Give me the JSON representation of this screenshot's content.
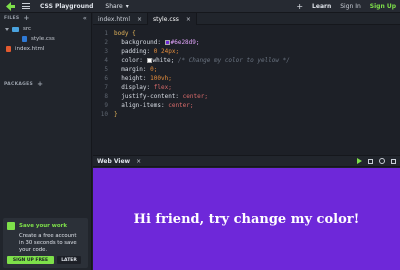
{
  "header": {
    "app_title": "CSS Playground",
    "share_label": "Share",
    "add_label": "+",
    "learn_label": "Learn",
    "sign_in_label": "Sign In",
    "sign_up_label": "Sign Up",
    "accent_color": "#7ee04a"
  },
  "sidebar": {
    "files_label": "FILES",
    "add_label": "+",
    "collapse_label": "«",
    "tree": {
      "folder": "src",
      "children": [
        "style.css"
      ],
      "root_files": [
        "index.html"
      ]
    },
    "packages_label": "PACKAGES",
    "packages_add": "+"
  },
  "save_card": {
    "title": "Save your work",
    "line1": "Create a free account",
    "line2": "in 30 seconds to save",
    "line3": "your code.",
    "signup_label": "SIGN UP FREE",
    "later_label": "LATER"
  },
  "tabs": [
    {
      "label": "index.html",
      "close": "×"
    },
    {
      "label": "style.css",
      "close": "×"
    }
  ],
  "editor": {
    "line_numbers": [
      "1",
      "2",
      "3",
      "4",
      "5",
      "6",
      "7",
      "8",
      "9",
      "10"
    ],
    "selector": "body",
    "open_brace": "{",
    "close_brace": "}",
    "decls": [
      {
        "prop": "background:",
        "value": "#6e28d9;",
        "swatch": "#6e28d9"
      },
      {
        "prop": "padding:",
        "value": "0 24px;"
      },
      {
        "prop": "color:",
        "value": "white;",
        "swatch": "#ffffff",
        "comment": "/* Change my color to yellow */"
      },
      {
        "prop": "margin:",
        "value": "0;"
      },
      {
        "prop": "height:",
        "value": "100vh;"
      },
      {
        "prop": "display:",
        "value": "flex;"
      },
      {
        "prop": "justify-content:",
        "value": "center;"
      },
      {
        "prop": "align-items:",
        "value": "center;"
      }
    ]
  },
  "webview": {
    "title": "Web View",
    "close": "×",
    "background": "#6e28d9",
    "heading": "Hi friend, try change my color!"
  }
}
